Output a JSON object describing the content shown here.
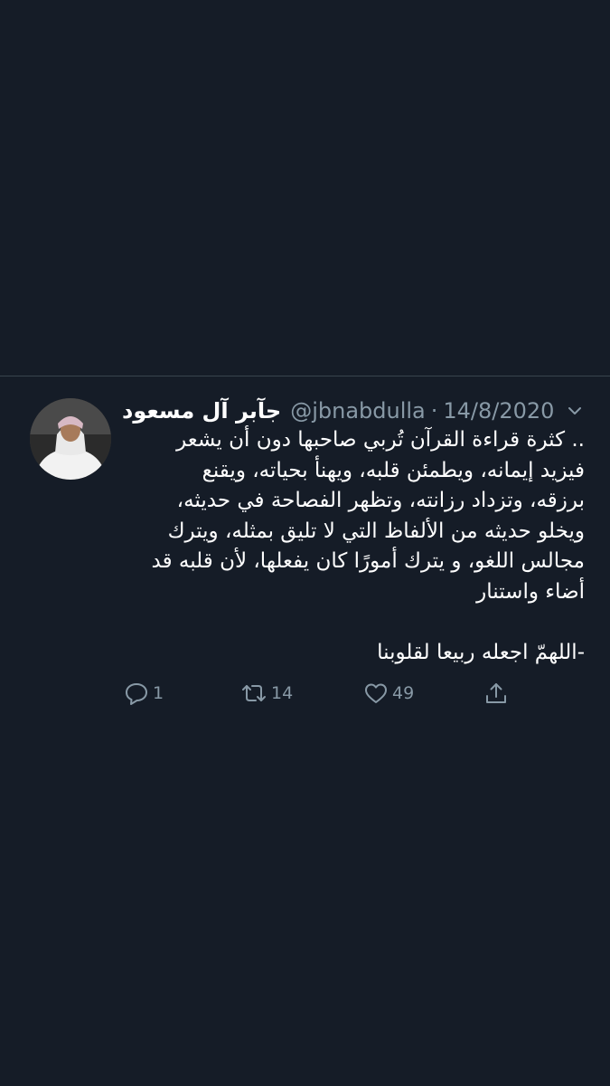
{
  "tweet": {
    "display_name": "جآبر آل مسعود",
    "handle": "@jbnabdulla",
    "separator": "·",
    "date": "14/8/2020",
    "text_lines": [
      ".. كثرة قراءة القرآن تُربي صاحبها دون أن يشعر",
      "فيزيد إيمانه، ويطمئن قلبه، ويهنأ بحياته، ويقنع",
      "برزقه، وتزداد رزانته، وتظهر الفصاحة في حديثه،",
      "ويخلو حديثه من الألفاظ التي لا تليق بمثله، ويترك",
      "مجالس اللغو، و يترك أمورًا كان يفعلها، لأن قلبه قد",
      "أضاء واستنار"
    ],
    "closing_line": "-اللهمّ اجعله ربيعا لقلوبنا",
    "actions": {
      "reply_count": "1",
      "retweet_count": "14",
      "like_count": "49"
    }
  },
  "icons": {
    "reply": "reply-bubble-icon",
    "retweet": "retweet-icon",
    "like": "heart-icon",
    "share": "share-icon",
    "menu": "chevron-down-icon"
  },
  "colors": {
    "background": "#151c27",
    "text": "#ffffff",
    "secondary": "#8899a6",
    "divider": "#38444d"
  }
}
